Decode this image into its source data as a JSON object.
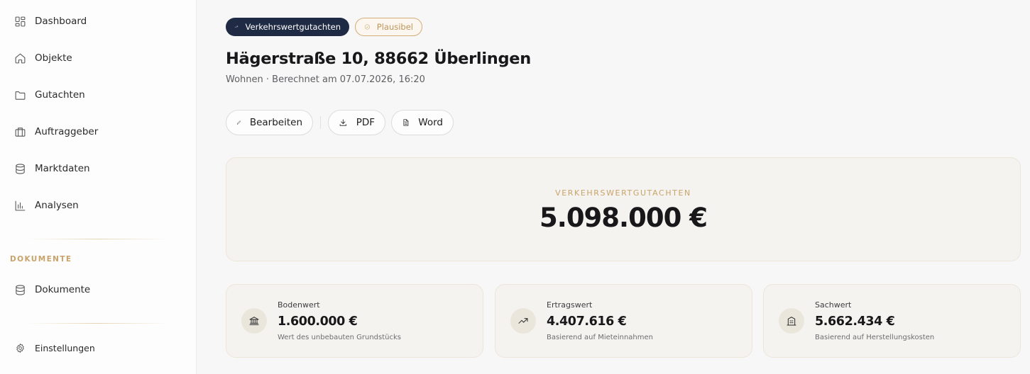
{
  "sidebar": {
    "items": [
      {
        "label": "Dashboard",
        "icon": "dashboard-icon"
      },
      {
        "label": "Objekte",
        "icon": "home-icon"
      },
      {
        "label": "Gutachten",
        "icon": "folder-icon"
      },
      {
        "label": "Auftraggeber",
        "icon": "briefcase-icon"
      },
      {
        "label": "Marktdaten",
        "icon": "database-icon"
      },
      {
        "label": "Analysen",
        "icon": "bar-chart-icon"
      }
    ],
    "section_label": "DOKUMENTE",
    "documents_item": {
      "label": "Dokumente",
      "icon": "database-icon"
    },
    "settings_label": "Einstellungen"
  },
  "header": {
    "badge_type": "Verkehrswertgutachten",
    "badge_status": "Plausibel",
    "title": "Hägerstraße 10, 88662 Überlingen",
    "subtitle": "Wohnen · Berechnet am 07.07.2026, 16:20"
  },
  "actions": {
    "edit_label": "Bearbeiten",
    "pdf_label": "PDF",
    "word_label": "Word"
  },
  "summary": {
    "label": "VERKEHRSWERTGUTACHTEN",
    "value": "5.098.000 €"
  },
  "cards": [
    {
      "label": "Bodenwert",
      "value": "1.600.000 €",
      "description": "Wert des unbebauten Grundstücks",
      "icon": "bank-icon"
    },
    {
      "label": "Ertragswert",
      "value": "4.407.616 €",
      "description": "Basierend auf Mieteinnahmen",
      "icon": "trending-up-icon"
    },
    {
      "label": "Sachwert",
      "value": "5.662.434 €",
      "description": "Basierend auf Herstellungskosten",
      "icon": "building-icon"
    }
  ],
  "colors": {
    "accent_gold": "#c9a36a",
    "navy": "#1f2a44",
    "card_bg": "#f5f3ef"
  }
}
